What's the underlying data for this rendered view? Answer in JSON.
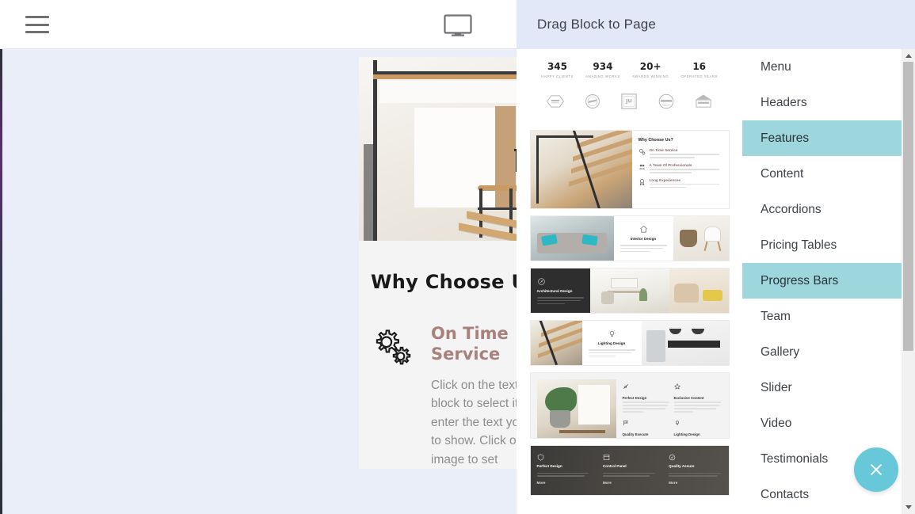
{
  "toolbar": {
    "menu_icon": "hamburger-menu-icon",
    "device_icon": "desktop-monitor-icon"
  },
  "panel": {
    "header_title": "Drag Block to Page",
    "close_icon": "close-x-icon",
    "categories": [
      {
        "label": "Menu",
        "active": false
      },
      {
        "label": "Headers",
        "active": false
      },
      {
        "label": "Features",
        "active": true
      },
      {
        "label": "Content",
        "active": false
      },
      {
        "label": "Accordions",
        "active": false
      },
      {
        "label": "Pricing Tables",
        "active": false
      },
      {
        "label": "Progress Bars",
        "active": true
      },
      {
        "label": "Team",
        "active": false
      },
      {
        "label": "Gallery",
        "active": false
      },
      {
        "label": "Slider",
        "active": false
      },
      {
        "label": "Video",
        "active": false
      },
      {
        "label": "Testimonials",
        "active": false
      },
      {
        "label": "Contacts",
        "active": false
      }
    ],
    "blocks": {
      "counters": [
        {
          "number": "345",
          "caption": "HAPPY CLIENTS"
        },
        {
          "number": "934",
          "caption": "AMAZING WORKS"
        },
        {
          "number": "20+",
          "caption": "AWARDS WINNING"
        },
        {
          "number": "16",
          "caption": "OPERATED YEARS"
        }
      ],
      "logos_count": 5,
      "why_choose": {
        "title": "Why Choose Us?",
        "items": [
          {
            "title": "On Time Service",
            "icon": "gears-icon"
          },
          {
            "title": "A Team Of Professionals",
            "icon": "team-icon"
          },
          {
            "title": "Long Experiences",
            "icon": "badge-icon"
          }
        ]
      },
      "interior": {
        "title": "Interior Design",
        "icon": "home-icon"
      },
      "architectural": {
        "title": "Architectural Design",
        "icon": "compass-icon"
      },
      "lighting": {
        "title": "Lighting Design",
        "icon": "bulb-icon"
      },
      "four_up": {
        "cells": [
          {
            "title": "Perfect Design",
            "icon": "brush-icon"
          },
          {
            "title": "Exclusive Content",
            "icon": "star-icon"
          },
          {
            "title": "Quality Execute",
            "icon": "flag-icon"
          },
          {
            "title": "Lighting Design",
            "icon": "bulb-icon"
          }
        ]
      },
      "dark_three": {
        "cells": [
          {
            "title": "Perfect Design",
            "link": "More",
            "icon": "shield-icon"
          },
          {
            "title": "Control Panel",
            "link": "More",
            "icon": "panel-icon"
          },
          {
            "title": "Quality Assure",
            "link": "More",
            "icon": "check-icon"
          }
        ]
      }
    },
    "scrollbars": {
      "thumbs_scroll": {
        "up_icon": "scroll-up-arrow-icon",
        "down_icon": "scroll-down-arrow-icon"
      },
      "cats_scroll": {
        "up_icon": "scroll-up-arrow-icon",
        "down_icon": "scroll-down-arrow-icon"
      }
    }
  },
  "page": {
    "hero_alt": "modern-staircase-interior-photo",
    "title": "Why Choose Us?",
    "feature": {
      "icon": "gears-icon",
      "title": "On Time Service",
      "description": "Click on the text in the block to select it and enter the text you want to show. Click on the image to set"
    }
  },
  "colors": {
    "accent_teal": "#9ed6de",
    "fab_teal": "#66c8d8",
    "panel_header": "#e2e8f7",
    "canvas_bg": "#eaeef9",
    "feature_title": "#a8807c"
  }
}
